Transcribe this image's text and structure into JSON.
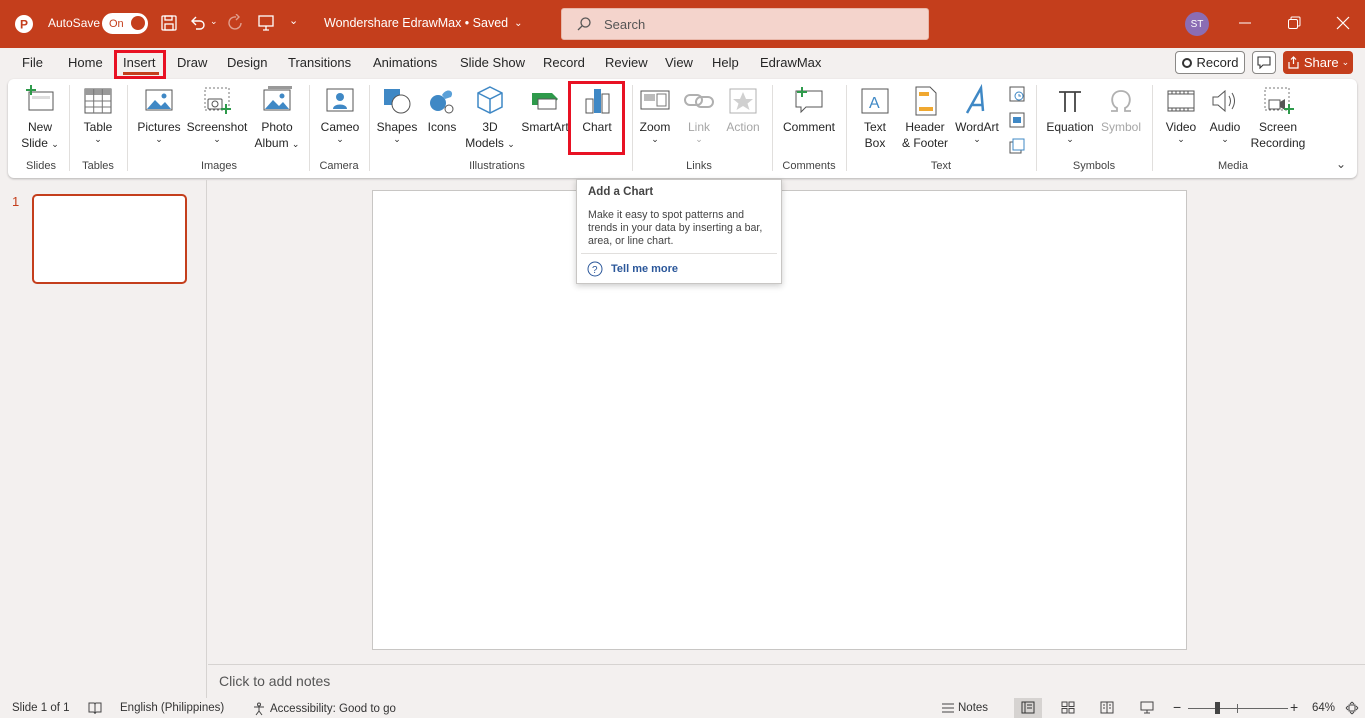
{
  "titlebar": {
    "autosave_label": "AutoSave",
    "toggle_state": "On",
    "doc_title": "Wondershare EdrawMax • Saved",
    "search_placeholder": "Search",
    "user_initials": "ST"
  },
  "menu": {
    "tabs": [
      "File",
      "Home",
      "Insert",
      "Draw",
      "Design",
      "Transitions",
      "Animations",
      "Slide Show",
      "Record",
      "Review",
      "View",
      "Help",
      "EdrawMax"
    ],
    "active_tab": "Insert",
    "record_label": "Record",
    "share_label": "Share"
  },
  "ribbon": {
    "new_slide": [
      "New",
      "Slide"
    ],
    "table": "Table",
    "pictures": "Pictures",
    "screenshot": "Screenshot",
    "photo_album": [
      "Photo",
      "Album"
    ],
    "cameo": "Cameo",
    "shapes": "Shapes",
    "icons": "Icons",
    "models3d": [
      "3D",
      "Models"
    ],
    "smartart": "SmartArt",
    "chart": "Chart",
    "zoom": "Zoom",
    "link": "Link",
    "action": "Action",
    "comment": "Comment",
    "textbox": [
      "Text",
      "Box"
    ],
    "header_footer": [
      "Header",
      "& Footer"
    ],
    "wordart": "WordArt",
    "equation": "Equation",
    "symbol": "Symbol",
    "video": "Video",
    "audio": "Audio",
    "screen_recording": [
      "Screen",
      "Recording"
    ],
    "groups": {
      "slides": "Slides",
      "tables": "Tables",
      "images": "Images",
      "camera": "Camera",
      "illustrations": "Illustrations",
      "links": "Links",
      "comments": "Comments",
      "text": "Text",
      "symbols": "Symbols",
      "media": "Media"
    }
  },
  "tooltip": {
    "title": "Add a Chart",
    "body": "Make it easy to spot patterns and trends in your data by inserting a bar, area, or line chart.",
    "link": "Tell me more"
  },
  "thumbnails": {
    "slide_number": "1"
  },
  "notes": {
    "placeholder": "Click to add notes"
  },
  "status": {
    "slide_info": "Slide 1 of 1",
    "language": "English (Philippines)",
    "accessibility": "Accessibility: Good to go",
    "notes_label": "Notes",
    "zoom_minus": "−",
    "zoom_plus": "+",
    "zoom_level": "64%"
  },
  "colors": {
    "accent": "#c43e1c",
    "highlight": "#e81123",
    "link": "#2b579a"
  }
}
